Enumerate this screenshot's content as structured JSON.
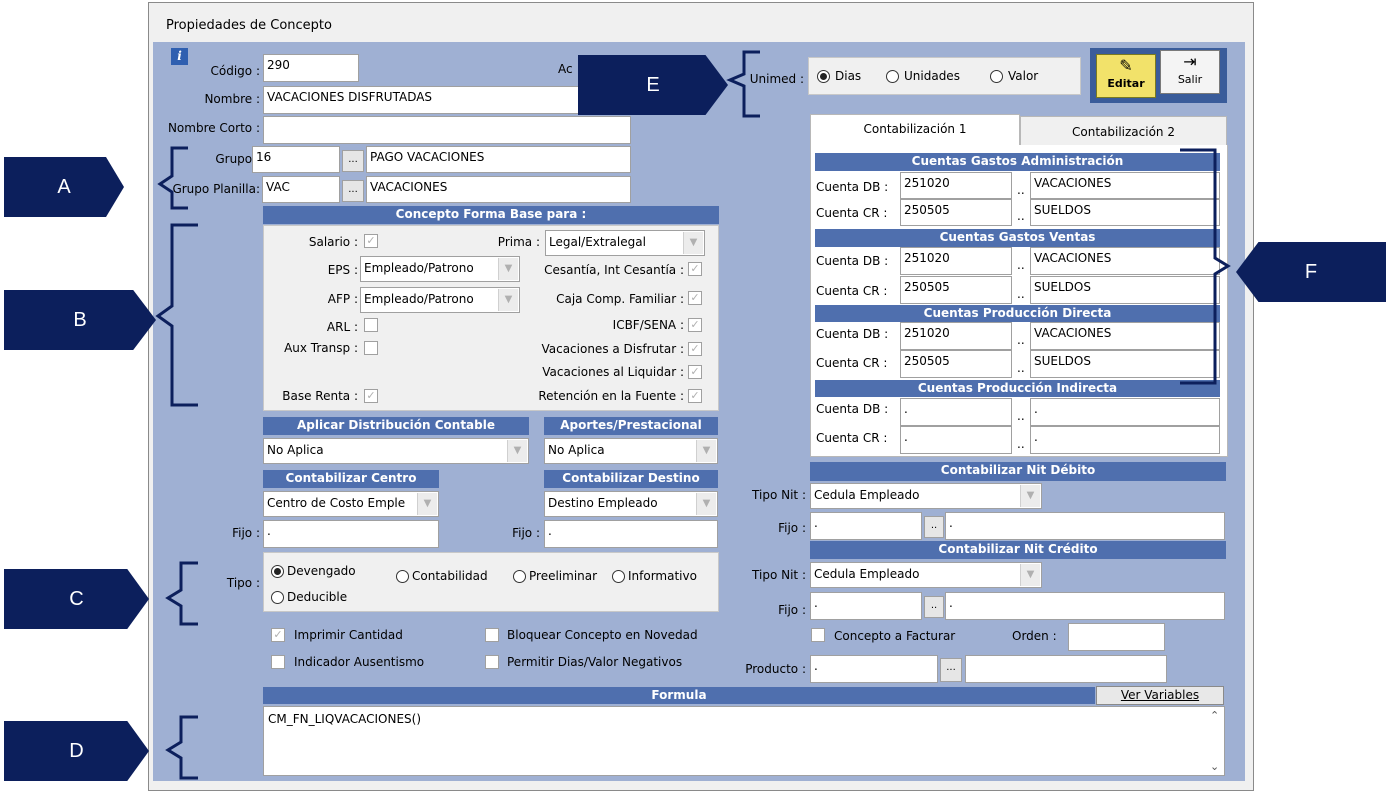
{
  "window": {
    "title": "Propiedades de Concepto"
  },
  "markers": {
    "a": "A",
    "b": "B",
    "c": "C",
    "d": "D",
    "e": "E",
    "f": "F"
  },
  "top": {
    "codigo_label": "Código :",
    "codigo_value": "290",
    "ac_label": "Ac",
    "nombre_label": "Nombre :",
    "nombre_value": "VACACIONES DISFRUTADAS",
    "nombre_corto_label": "Nombre Corto :",
    "nombre_corto_value": "",
    "grupo_label": "Grupo :",
    "grupo_code": "16",
    "grupo_desc": "PAGO VACACIONES",
    "grupo_planilla_label": "Grupo Planilla:",
    "grupo_planilla_code": "VAC",
    "grupo_planilla_desc": "VACACIONES",
    "dots": "..."
  },
  "unimed": {
    "label": "Unimed :",
    "options": [
      "Dias",
      "Unidades",
      "Valor"
    ],
    "selected": "Dias"
  },
  "toolbar": {
    "editar": "Editar",
    "salir": "Salir"
  },
  "base": {
    "header": "Concepto Forma Base para :",
    "salario": "Salario :",
    "prima": "Prima :",
    "prima_value": "Legal/Extralegal",
    "eps": "EPS :",
    "eps_value": "Empleado/Patrono",
    "cesantia": "Cesantía, Int Cesantía :",
    "afp": "AFP :",
    "afp_value": "Empleado/Patrono",
    "caja": "Caja Comp. Familiar :",
    "arl": "ARL :",
    "icbf": "ICBF/SENA :",
    "aux": "Aux Transp :",
    "vac_disfrutar": "Vacaciones a Disfrutar :",
    "vac_liquidar": "Vacaciones al Liquidar :",
    "base_renta": "Base Renta :",
    "retencion": "Retención en la Fuente :",
    "check": "✓"
  },
  "distribucion": {
    "header": "Aplicar Distribución Contable",
    "value": "No Aplica"
  },
  "aportes": {
    "header": "Aportes/Prestacional",
    "value": "No Aplica"
  },
  "centro": {
    "header": "Contabilizar Centro",
    "value": "Centro de Costo Emple",
    "fijo_label": "Fijo :",
    "fijo_value": "."
  },
  "destino": {
    "header": "Contabilizar Destino",
    "value": "Destino Empleado",
    "fijo_label": "Fijo :",
    "fijo_value": "."
  },
  "tipo": {
    "label": "Tipo :",
    "options": [
      "Devengado",
      "Contabilidad",
      "Preeliminar",
      "Informativo",
      "Deducible"
    ],
    "selected": "Devengado"
  },
  "flags": {
    "imprimir": "Imprimir Cantidad",
    "bloquear": "Bloquear Concepto en Novedad",
    "ausentismo": "Indicador Ausentismo",
    "negativos": "Permitir Dias/Valor Negativos"
  },
  "formula": {
    "header": "Formula",
    "ver_variables": "Ver Variables",
    "value": "CM_FN_LIQVACACIONES()"
  },
  "tabs": {
    "tab1": "Contabilización 1",
    "tab2": "Contabilización 2"
  },
  "cuentas": {
    "db_label": "Cuenta DB :",
    "cr_label": "Cuenta CR :",
    "dots": "..",
    "admin": {
      "header": "Cuentas Gastos Administración",
      "db": "251020",
      "db_desc": "VACACIONES",
      "cr": "250505",
      "cr_desc": "SUELDOS"
    },
    "ventas": {
      "header": "Cuentas Gastos Ventas",
      "db": "251020",
      "db_desc": "VACACIONES",
      "cr": "250505",
      "cr_desc": "SUELDOS"
    },
    "directa": {
      "header": "Cuentas Producción Directa",
      "db": "251020",
      "db_desc": "VACACIONES",
      "cr": "250505",
      "cr_desc": "SUELDOS"
    },
    "indirecta": {
      "header": "Cuentas Producción Indirecta",
      "db": ".",
      "db_desc": ".",
      "cr": ".",
      "cr_desc": "."
    }
  },
  "nit_debito": {
    "header": "Contabilizar Nit Débito",
    "tipo_label": "Tipo Nit :",
    "tipo_value": "Cedula Empleado",
    "fijo_label": "Fijo :",
    "fijo_value": ".",
    "fijo_desc": "."
  },
  "nit_credito": {
    "header": "Contabilizar Nit Crédito",
    "tipo_label": "Tipo Nit :",
    "tipo_value": "Cedula Empleado",
    "fijo_label": "Fijo :",
    "fijo_value": ".",
    "fijo_desc": "."
  },
  "facturar": {
    "label": "Concepto a Facturar",
    "orden_label": "Orden :",
    "orden_value": "",
    "producto_label": "Producto :",
    "producto_value": ".",
    "producto_desc": "",
    "dots": "..."
  }
}
